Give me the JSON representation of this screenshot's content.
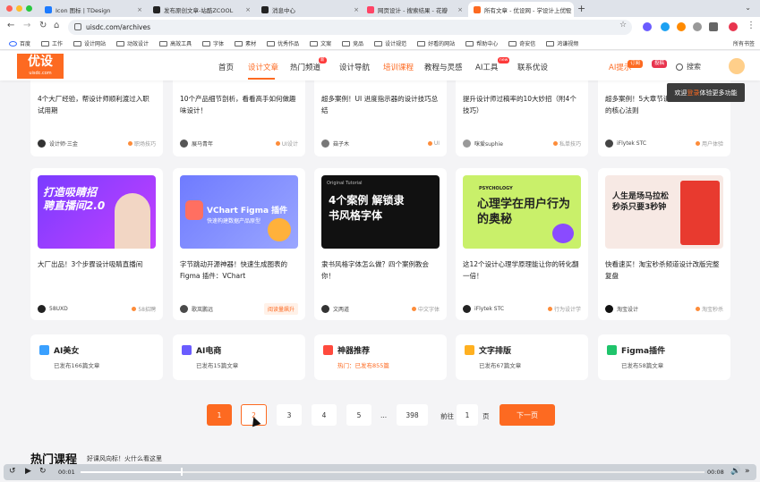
{
  "browser": {
    "tabs": [
      {
        "title": "Icon 图标 | TDesign",
        "fav": "#1d7bff"
      },
      {
        "title": "发布原创文章-站酷ZCOOL",
        "fav": "#222222"
      },
      {
        "title": "消息中心",
        "fav": "#222222"
      },
      {
        "title": "网页设计 - 搜索结果 - 花瓣",
        "fav": "#ff4466"
      },
      {
        "title": "所有文章 - 优设网 - 学设计上优设",
        "fav": "#fd6a21"
      }
    ],
    "url": "uisdc.com/archives",
    "bookmarks": [
      "百度",
      "工作",
      "设计网站",
      "动效设计",
      "高效工具",
      "字体",
      "素材",
      "优秀作品",
      "文案",
      "竞品",
      "设计规范",
      "好看的网站",
      "帮助中心",
      "奇安信",
      "鸿谦视频"
    ],
    "all_bookmarks": "所有书签"
  },
  "site": {
    "logo_main": "优设",
    "logo_sub": "uisdc.com",
    "nav": [
      "首页",
      "设计文章",
      "热门频道",
      "设计导航",
      "培训课程",
      "教程与灵感",
      "AI工具",
      "联系优设"
    ],
    "nav_badges": {
      "hot": "新",
      "ai": "new"
    },
    "ai_tip": "AI提示",
    "subscribe": "订阅",
    "submit": "投稿",
    "search": "搜索",
    "tooltip_a": "欢迎",
    "tooltip_b": "登录",
    "tooltip_c": "体验更多功能"
  },
  "top_cards": [
    {
      "title": "4个大厂经验，帮设计师顺利渡过入职试用期",
      "author": "设计师·三金",
      "tag": "职场技巧",
      "av": "#333333"
    },
    {
      "title": "10个产品细节剖析，看看高手如何做趣味设计！",
      "author": "展马青年",
      "tag": "UI设计",
      "av": "#555555"
    },
    {
      "title": "超多案例！UI 进度指示器的设计技巧总结",
      "author": "菇子木",
      "tag": "UI",
      "av": "#777777"
    },
    {
      "title": "提升设计师过稿率的10大妙招（附4个技巧）",
      "author": "咪爱suphie",
      "tag": "私单技巧",
      "av": "#999999"
    },
    {
      "title": "超多案例！5大章节讲透产品的吸引力的核心法则",
      "author": "iFlytek STC",
      "tag": "用户体验",
      "av": "#444444"
    }
  ],
  "cards": [
    {
      "title": "大厂出品！3个步骤设计吸睛直播间",
      "author": "58UXD",
      "tag": "58招聘",
      "av": "#222222",
      "thumb_text": "打造吸睛招聘直播间2.0"
    },
    {
      "title": "字节跳动开源神器！快速生成图表的 Figma 插件：VChart",
      "author": "歌岚鹏远",
      "tag": "阅读量飙升",
      "av": "#4a4a4a",
      "thumb_text": "VChart Figma 插件",
      "thumb_sub": "快速构建数据产品原型"
    },
    {
      "title": "隶书风格字体怎么做？四个案例教会你！",
      "author": "文两道",
      "tag": "中文字体",
      "av": "#333333",
      "thumb_text": "4个案例 解锁隶书风格字体",
      "thumb_sub": "Original Tutorial"
    },
    {
      "title": "这12个设计心理学原理能让你的转化翻一倍！",
      "author": "iFlytek STC",
      "tag": "行为设计学",
      "av": "#222222",
      "thumb_text": "心理学在用户行为的奥秘",
      "thumb_sub": "PSYCHOLOGY"
    },
    {
      "title": "快看速买！淘宝秒杀频道设计改版完整复盘",
      "author": "淘宝设计",
      "tag": "淘宝秒杀",
      "av": "#111111",
      "thumb_text": "人生是场马拉松 秒杀只要3秒钟"
    }
  ],
  "categories": [
    {
      "name": "AI美女",
      "count": "已发布166篇文章",
      "color": "#3aa0ff"
    },
    {
      "name": "AI电商",
      "count": "已发布15篇文章",
      "color": "#6a5cff"
    },
    {
      "name": "神器推荐",
      "count": "热门：已发布855篇",
      "color": "#ff4a3d"
    },
    {
      "name": "文字排版",
      "count": "已发布67篇文章",
      "color": "#ffb020"
    },
    {
      "name": "Figma插件",
      "count": "已发布58篇文章",
      "color": "#1fc46b"
    }
  ],
  "pagination": {
    "pages": [
      "1",
      "2",
      "3",
      "4",
      "5"
    ],
    "ellipsis": "...",
    "last": "398",
    "goto_label": "前往",
    "goto_value": "1",
    "page_unit": "页",
    "next": "下一页",
    "current": 1
  },
  "hot_courses": {
    "title": "热门课程",
    "subtitle": "好课风向标！火什么看这里"
  },
  "video": {
    "current": "00:01",
    "duration": "00:08",
    "progress": 0.16
  }
}
